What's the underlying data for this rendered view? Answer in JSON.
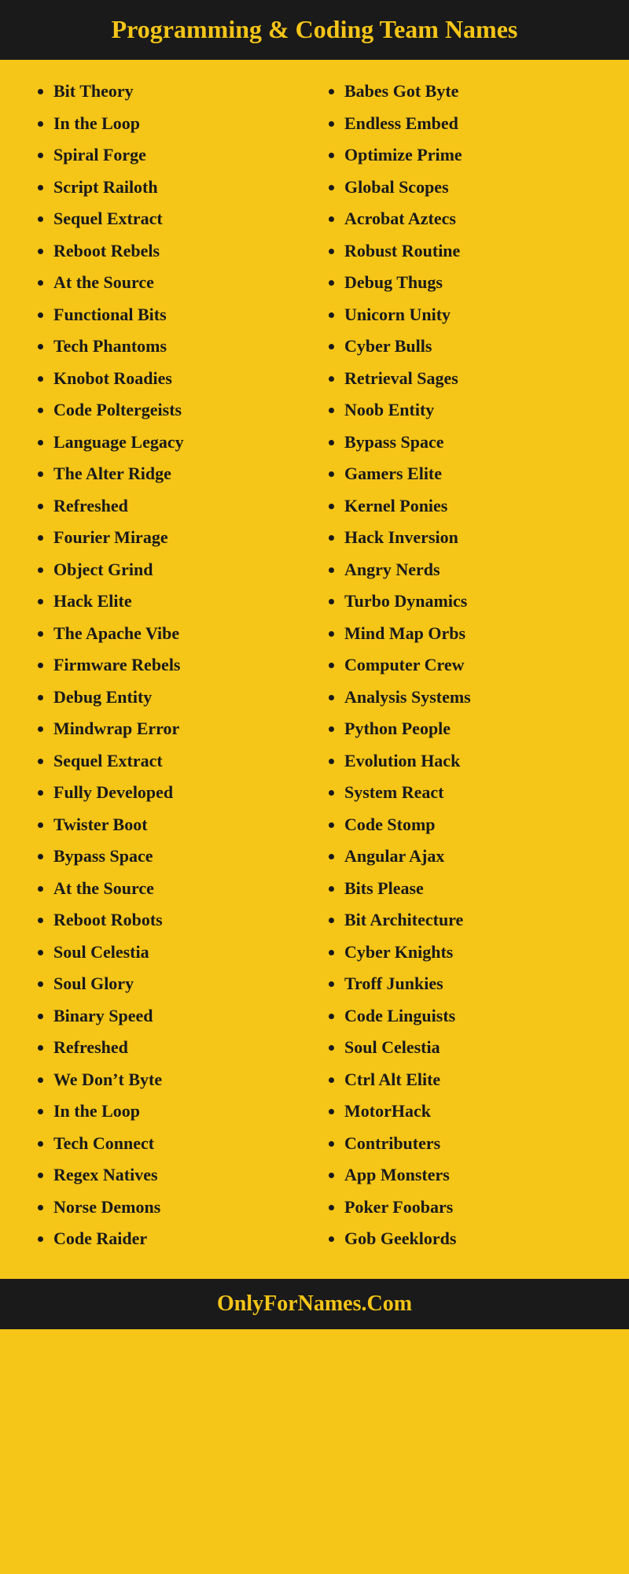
{
  "header": {
    "title": "Programming & Coding Team Names"
  },
  "left_column": {
    "items": [
      "Bit Theory",
      "In the Loop",
      "Spiral Forge",
      "Script Railoth",
      "Sequel Extract",
      "Reboot Rebels",
      "At the Source",
      "Functional Bits",
      "Tech Phantoms",
      "Knobot Roadies",
      "Code Poltergeists",
      "Language Legacy",
      "The Alter Ridge",
      "Refreshed",
      "Fourier Mirage",
      "Object Grind",
      "Hack Elite",
      "The Apache Vibe",
      "Firmware Rebels",
      "Debug Entity",
      "Mindwrap Error",
      "Sequel Extract",
      "Fully Developed",
      "Twister Boot",
      "Bypass Space",
      "At the Source",
      "Reboot Robots",
      "Soul Celestia",
      "Soul Glory",
      "Binary Speed",
      "Refreshed",
      "We Don’t Byte",
      "In the Loop",
      "Tech Connect",
      "Regex Natives",
      "Norse Demons",
      "Code Raider"
    ]
  },
  "right_column": {
    "items": [
      "Babes Got Byte",
      "Endless Embed",
      "Optimize Prime",
      "Global Scopes",
      "Acrobat Aztecs",
      "Robust Routine",
      "Debug Thugs",
      "Unicorn Unity",
      "Cyber Bulls",
      "Retrieval Sages",
      "Noob Entity",
      "Bypass Space",
      "Gamers Elite",
      "Kernel Ponies",
      "Hack Inversion",
      "Angry Nerds",
      "Turbo Dynamics",
      "Mind Map Orbs",
      "Computer Crew",
      "Analysis Systems",
      "Python People",
      "Evolution Hack",
      "System React",
      "Code Stomp",
      "Angular Ajax",
      "Bits Please",
      "Bit Architecture",
      "Cyber Knights",
      "Troff Junkies",
      "Code Linguists",
      "Soul Celestia",
      "Ctrl Alt Elite",
      "MotorHack",
      "Contributers",
      "App Monsters",
      "Poker Foobars",
      "Gob Geeklords"
    ]
  },
  "footer": {
    "text": "OnlyForNames.Com"
  }
}
